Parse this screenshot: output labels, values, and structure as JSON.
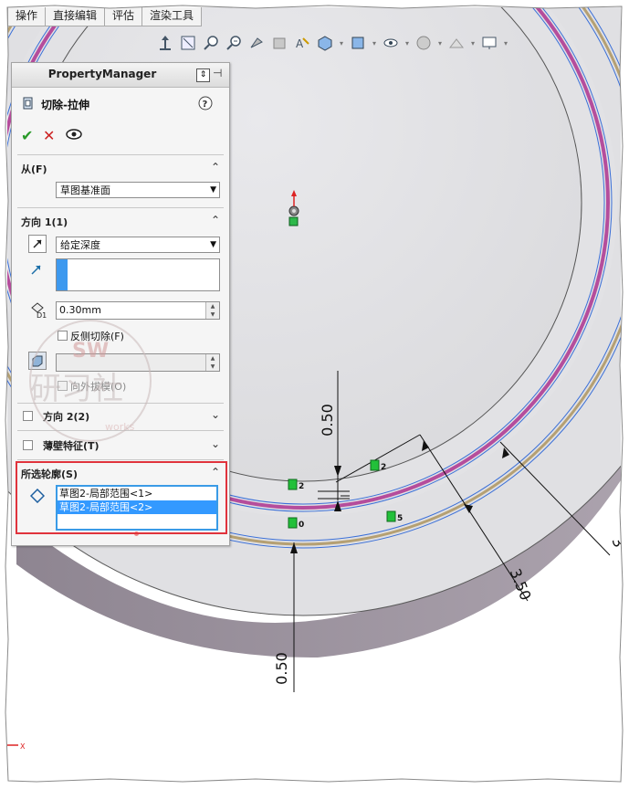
{
  "tabs": [
    "操作",
    "直接编辑",
    "评估",
    "渲染工具"
  ],
  "toolbar": {
    "icons": [
      "normal-to-icon",
      "zoom-to-fit-icon",
      "zoom-to-area-icon",
      "zoom-in-out-icon",
      "previous-view-icon",
      "section-view-icon",
      "dynamic-annotation-icon",
      "view-orientation-icon",
      "display-style-icon",
      "hide-show-items-icon",
      "edit-appearance-icon",
      "apply-scene-icon",
      "view-settings-icon"
    ]
  },
  "property_manager": {
    "header": "PropertyManager",
    "feature_title": "切除-拉伸",
    "from": {
      "label": "从(F)",
      "value": "草图基准面"
    },
    "direction1": {
      "label": "方向 1(1)",
      "end_condition": "给定深度",
      "depth": "0.30mm",
      "flip_side_label": "反侧切除(F)",
      "draft_outward_label": "向外拔模(O)"
    },
    "direction2": {
      "label": "方向 2(2)"
    },
    "thin_feature": {
      "label": "薄壁特征(T)"
    },
    "selected_contours": {
      "label": "所选轮廓(S)",
      "items": [
        "草图2-局部范围<1>",
        "草图2-局部范围<2>"
      ],
      "selected_index": 1
    }
  },
  "watermark": {
    "logo": "SW",
    "text": "研习社",
    "sub": "works"
  },
  "dimensions": [
    "0.50",
    "0.50",
    "3.50",
    "3"
  ],
  "markers": [
    "2",
    "2",
    "0",
    "5"
  ],
  "colors": {
    "face_light": "#e6e6e9",
    "face_mid": "#d9d9dc",
    "side_wall": "#908891",
    "contour_magenta": "#b54d9c",
    "contour_gold": "#b5a073",
    "edge_blue": "#3a6fd8",
    "selection_red": "#e0333c",
    "list_selected": "#3399ff"
  }
}
